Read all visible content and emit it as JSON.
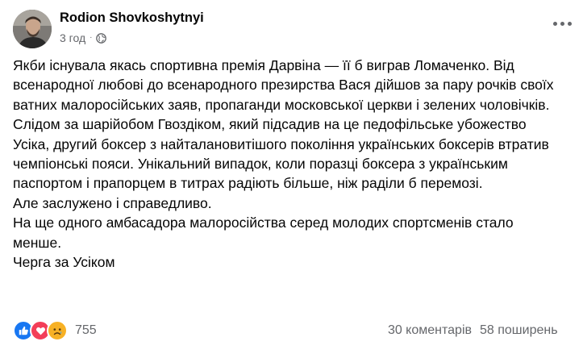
{
  "post": {
    "author": "Rodion Shovkoshytnyi",
    "time": "3 год",
    "separator": "·",
    "paragraphs": [
      "Якби існувала якась спортивна премія Дарвіна — її б виграв Ломаченко. Від всенародної любові до всенародного презирства Вася дійшов за пару рочків своїх ватних малоросійських заяв, пропаганди московської церкви і зелених чоловічків.",
      "Слідом за шарійобом Гвоздіком, який підсадив на це педофільське убожество Усіка, другий боксер з найталановитішого покоління українських боксерів втратив чемпіонські пояси. Унікальний випадок, коли поразці боксера з українським паспортом і прапорцем в титрах радіють більше, ніж раділи б перемозі.",
      "Але заслужено і справедливо.",
      "На ще одного амбасадора малоросійства серед молодих спортсменів стало менше.",
      "Черга за Усіком"
    ]
  },
  "icons": {
    "privacy": "globe-icon",
    "menu": "more-options-icon",
    "reactions": [
      "like-icon",
      "love-icon",
      "sad-icon"
    ]
  },
  "footer": {
    "reaction_count": "755",
    "comments": "30 коментарів",
    "shares": "58 поширень"
  },
  "colors": {
    "like": "#1877f2",
    "love": "#f33e58",
    "sad": "#f7b125",
    "secondary_text": "#65676b"
  }
}
